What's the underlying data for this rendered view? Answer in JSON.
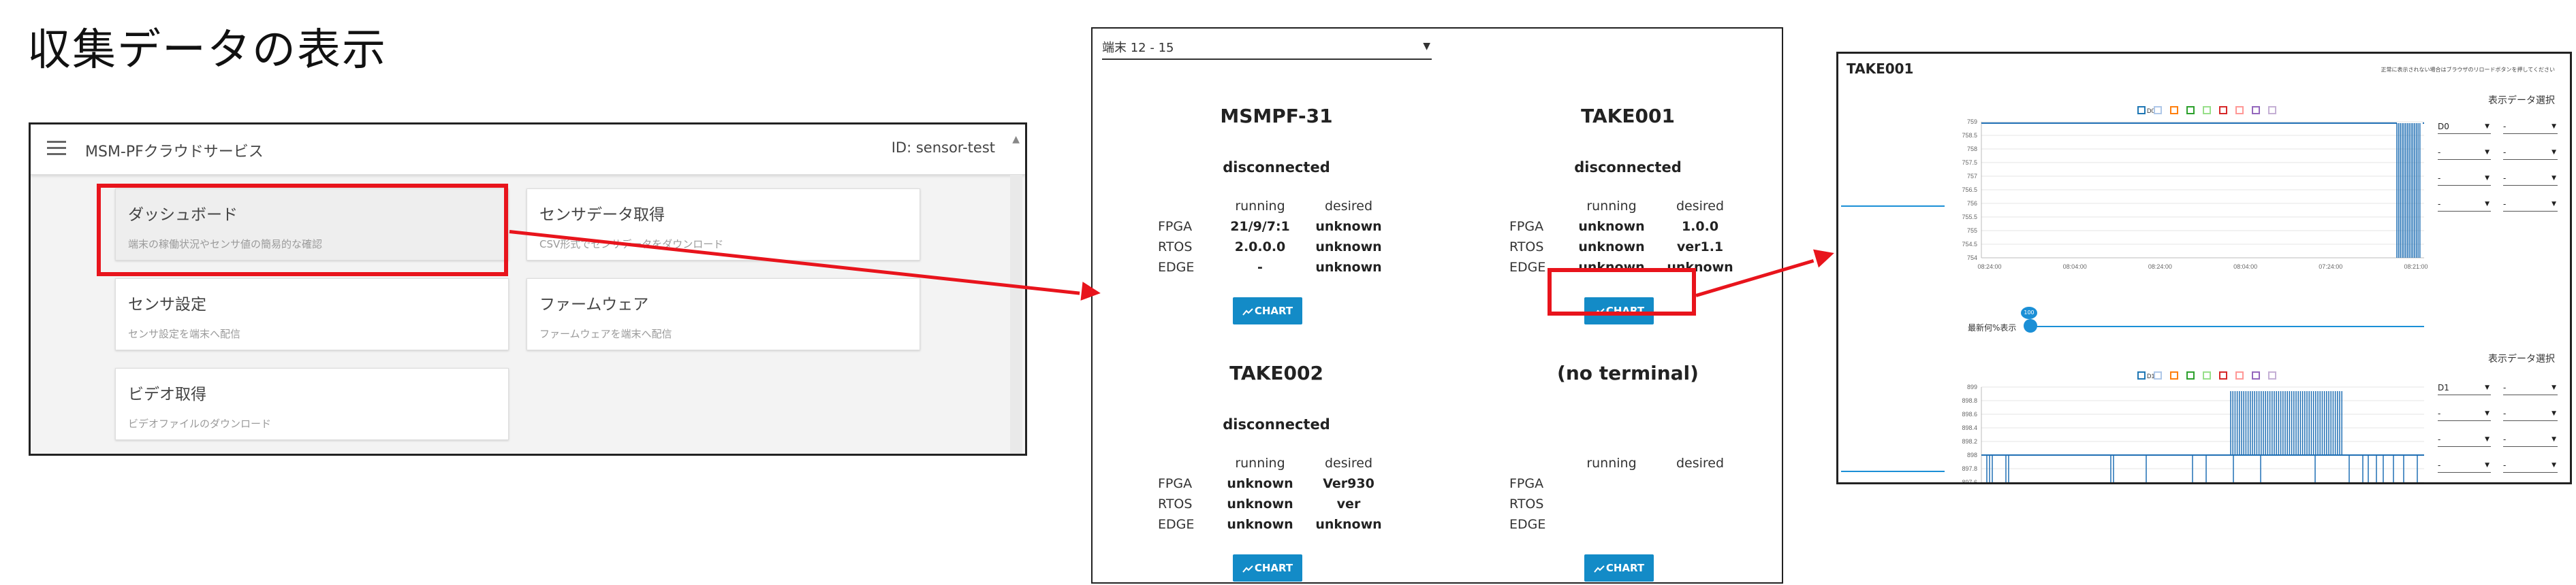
{
  "page": {
    "title": "収集データの表示"
  },
  "cloud_service": {
    "app_title": "MSM-PFクラウドサービス",
    "user_id": "ID: sensor-test",
    "cards": [
      {
        "title": "ダッシュボード",
        "desc": "端末の稼働状況やセンサ値の簡易的な確認"
      },
      {
        "title": "センサデータ取得",
        "desc": "CSV形式でセンサデータをダウンロード"
      },
      {
        "title": "センサ設定",
        "desc": "センサ設定を端末へ配信"
      },
      {
        "title": "ファームウェア",
        "desc": "ファームウェアを端末へ配信"
      },
      {
        "title": "ビデオ取得",
        "desc": "ビデオファイルのダウンロード"
      }
    ]
  },
  "dashboard": {
    "terminal_select": "端末 12 - 15",
    "col_running": "running",
    "col_desired": "desired",
    "row_labels": [
      "FPGA",
      "RTOS",
      "EDGE"
    ],
    "chart_button": "CHART",
    "terminals": [
      {
        "name": "MSMPF-31",
        "status": "disconnected",
        "running": [
          "21/9/7:1",
          "2.0.0.0",
          "-"
        ],
        "desired": [
          "unknown",
          "unknown",
          "unknown"
        ]
      },
      {
        "name": "TAKE001",
        "status": "disconnected",
        "running": [
          "unknown",
          "unknown",
          "unknown"
        ],
        "desired": [
          "1.0.0",
          "ver1.1",
          "unknown"
        ]
      },
      {
        "name": "TAKE002",
        "status": "disconnected",
        "running": [
          "unknown",
          "unknown",
          "unknown"
        ],
        "desired": [
          "Ver930",
          "ver",
          "unknown"
        ]
      },
      {
        "name": "(no terminal)",
        "status": "",
        "running": [
          "",
          "",
          ""
        ],
        "desired": [
          "",
          "",
          ""
        ]
      }
    ]
  },
  "chart_view": {
    "title": "TAKE001",
    "note": "正常に表示されない場合はブラウザのリロードボタンを押してください",
    "select_title": "表示データ選択",
    "slider_label": "最新何%表示",
    "slider_value": "100",
    "top_chart": {
      "select_rows": [
        [
          "D0",
          "-"
        ],
        [
          "-",
          "-"
        ],
        [
          "-",
          "-"
        ],
        [
          "-",
          "-"
        ]
      ],
      "legend": [
        "D0",
        "",
        "",
        "",
        "",
        "",
        "",
        "",
        ""
      ],
      "y_ticks": [
        "759",
        "758.5",
        "758",
        "757.5",
        "757",
        "756.5",
        "756",
        "755.5",
        "755",
        "754.5",
        "754"
      ],
      "x_ticks": [
        "08:24:00",
        "08:04:00",
        "08:24:00",
        "08:04:00",
        "07:24:00",
        "08:21:00"
      ]
    },
    "bottom_chart": {
      "select_rows": [
        [
          "D1",
          "-"
        ],
        [
          "-",
          "-"
        ],
        [
          "-",
          "-"
        ],
        [
          "-",
          "-"
        ]
      ],
      "legend": [
        "D1",
        "",
        "",
        "",
        "",
        "",
        "",
        "",
        ""
      ],
      "y_ticks": [
        "899",
        "898.8",
        "898.6",
        "898.4",
        "898.2",
        "898",
        "897.8",
        "897.6",
        "897.4",
        "897.2",
        "897"
      ],
      "x_ticks": [
        "08:24:00",
        "08:04:00",
        "08:24:00",
        "08:04:00",
        "07:24:00",
        "08:21:00"
      ]
    },
    "series_colors": [
      "#1f77b4",
      "#aec7e8",
      "#ff7f0e",
      "#2ca02c",
      "#98df8a",
      "#d62728",
      "#ff9896",
      "#9467bd",
      "#c5b0d5"
    ]
  }
}
